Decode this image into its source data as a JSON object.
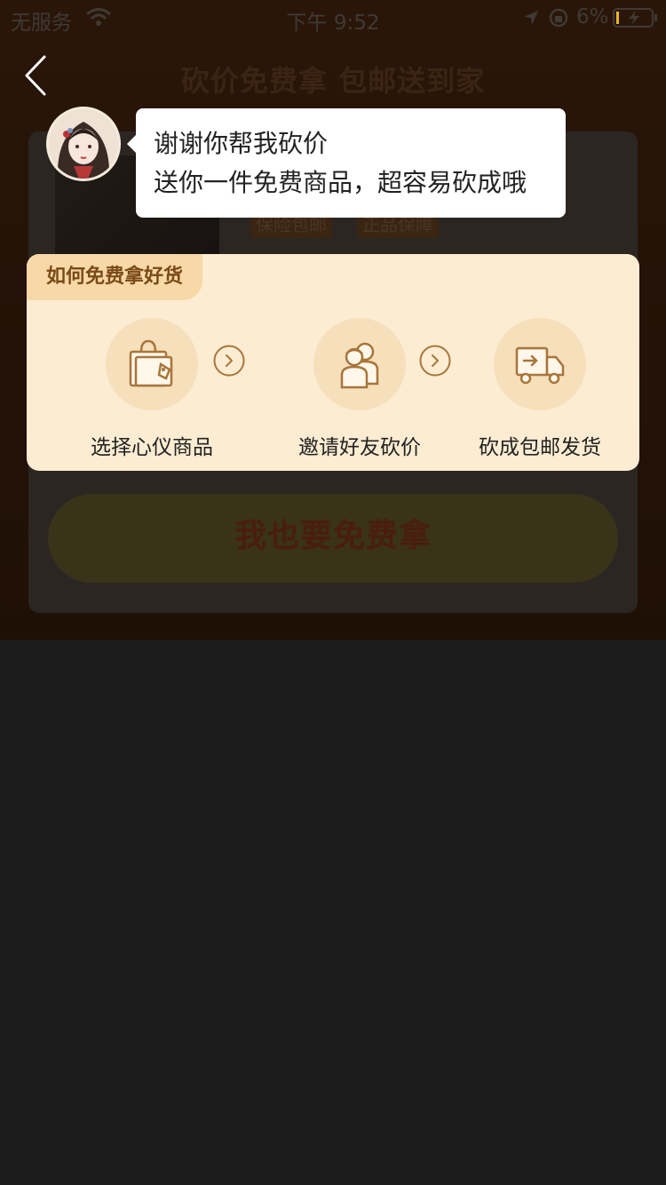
{
  "status_bar": {
    "carrier": "无服务",
    "time": "下午 9:52",
    "battery_percent": "6%"
  },
  "header": {
    "title": "砍价免费拿 包邮送到家"
  },
  "product": {
    "name": "…",
    "tags": [
      "保险包邮",
      "正品保障"
    ]
  },
  "bubble": {
    "line1": "谢谢你帮我砍价",
    "line2": "送你一件免费商品，超容易砍成哦"
  },
  "how_to": {
    "title": "如何免费拿好货",
    "steps": [
      {
        "label": "选择心仪商品",
        "icon": "shopping-bag-icon"
      },
      {
        "label": "邀请好友砍价",
        "icon": "friends-icon"
      },
      {
        "label": "砍成包邮发货",
        "icon": "delivery-truck-icon"
      }
    ]
  },
  "action": {
    "button_label": "我也要免费拿"
  },
  "colors": {
    "panel_bg": "#fcecd2",
    "tab_bg": "#f7d9a7",
    "icon_stroke": "#a8753a",
    "page_bg": "#1b1b1b"
  }
}
